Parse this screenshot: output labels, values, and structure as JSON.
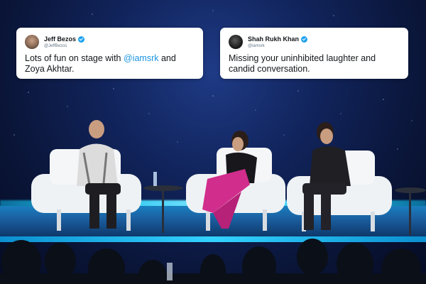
{
  "tweets": {
    "left": {
      "display_name": "Jeff Bezos",
      "handle": "@JeffBezos",
      "avatar_icon": "person-avatar",
      "verified_icon": "verified-badge",
      "text_before": "Lots of fun on stage with ",
      "mention": "@iamsrk",
      "text_after": " and Zoya Akhtar."
    },
    "right": {
      "display_name": "Shah Rukh Khan",
      "handle": "@iamsrk",
      "avatar_icon": "person-avatar",
      "verified_icon": "verified-badge",
      "text": "Missing your uninhibited laughter and candid conversation."
    }
  },
  "colors": {
    "mention": "#1b95e0",
    "verified": "#1da1f2",
    "stage_light": "#25c5ef",
    "backdrop": "#11245c"
  }
}
